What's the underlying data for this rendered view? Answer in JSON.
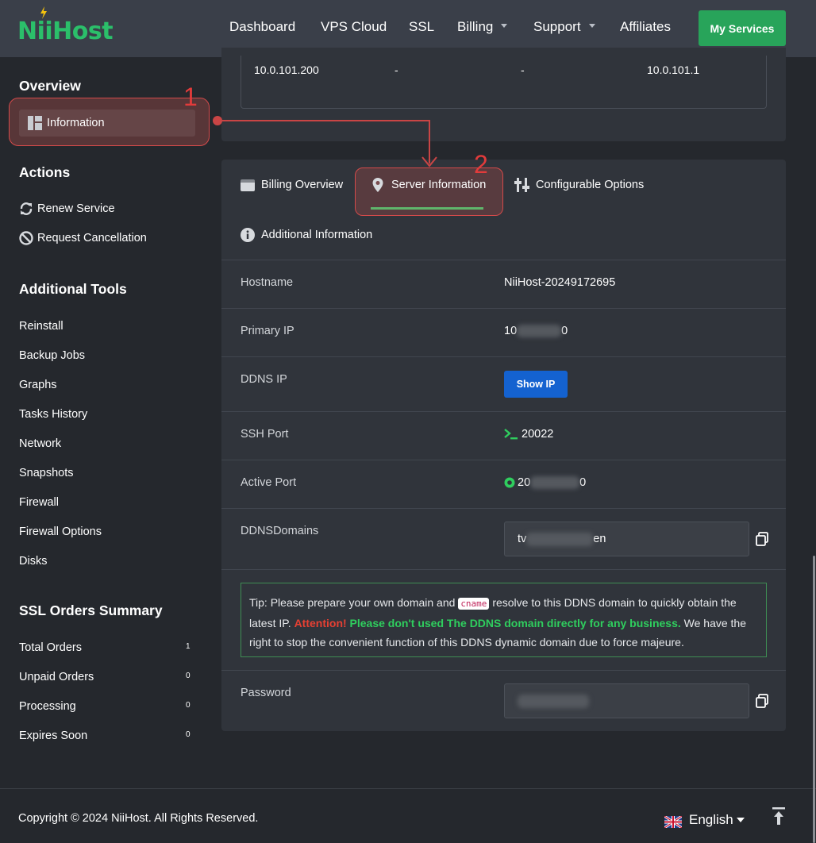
{
  "header": {
    "logo_text": "NiiHost",
    "nav": [
      "Dashboard",
      "VPS Cloud",
      "SSL",
      "Billing",
      "Support",
      "Affiliates"
    ],
    "cta": "My Services"
  },
  "sidebar": {
    "overview_heading": "Overview",
    "information_label": "Information",
    "actions_heading": "Actions",
    "actions": [
      "Renew Service",
      "Request Cancellation"
    ],
    "tools_heading": "Additional Tools",
    "tools": [
      "Reinstall",
      "Backup Jobs",
      "Graphs",
      "Tasks History",
      "Network",
      "Snapshots",
      "Firewall",
      "Firewall Options",
      "Disks"
    ],
    "ssl_heading": "SSL Orders Summary",
    "ssl": [
      {
        "label": "Total Orders",
        "count": "1"
      },
      {
        "label": "Unpaid Orders",
        "count": "0"
      },
      {
        "label": "Processing",
        "count": "0"
      },
      {
        "label": "Expires Soon",
        "count": "0"
      }
    ]
  },
  "annotations": {
    "first": "1",
    "second": "2"
  },
  "ip_row": {
    "ip": "10.0.101.200",
    "col2": "-",
    "col3": "-",
    "gateway": "10.0.101.1"
  },
  "tabs": [
    "Billing Overview",
    "Server Information",
    "Configurable Options",
    "Additional Information"
  ],
  "server_info": {
    "hostname_label": "Hostname",
    "hostname": "NiiHost-20249172695",
    "primary_ip_label": "Primary IP",
    "primary_ip_start": "10",
    "primary_ip_end": "0",
    "ddns_ip_label": "DDNS IP",
    "show_ip": "Show IP",
    "ssh_port_label": "SSH Port",
    "ssh_port": "20022",
    "active_port_label": "Active Port",
    "active_port_start": "20",
    "active_port_end": "0",
    "ddns_domains_label": "DDNSDomains",
    "ddns_start": "tv",
    "ddns_end": "en",
    "password_label": "Password"
  },
  "tip": {
    "part1": "Tip: Please prepare your own domain and ",
    "code": "cname",
    "part2": " resolve to this DDNS domain to quickly obtain the latest IP. ",
    "attention": "Attention!",
    "warning": " Please don't used The DDNS domain directly for any business.",
    "part3": " We have the right to stop the convenient function of this DDNS dynamic domain due to force majeure."
  },
  "footer": {
    "copyright": "Copyright © 2024 NiiHost. All Rights Reserved.",
    "language": "English"
  },
  "colors": {
    "accent_green": "#28a45a",
    "link_blue": "#1462d0",
    "annotation_red": "#e23b3b"
  }
}
